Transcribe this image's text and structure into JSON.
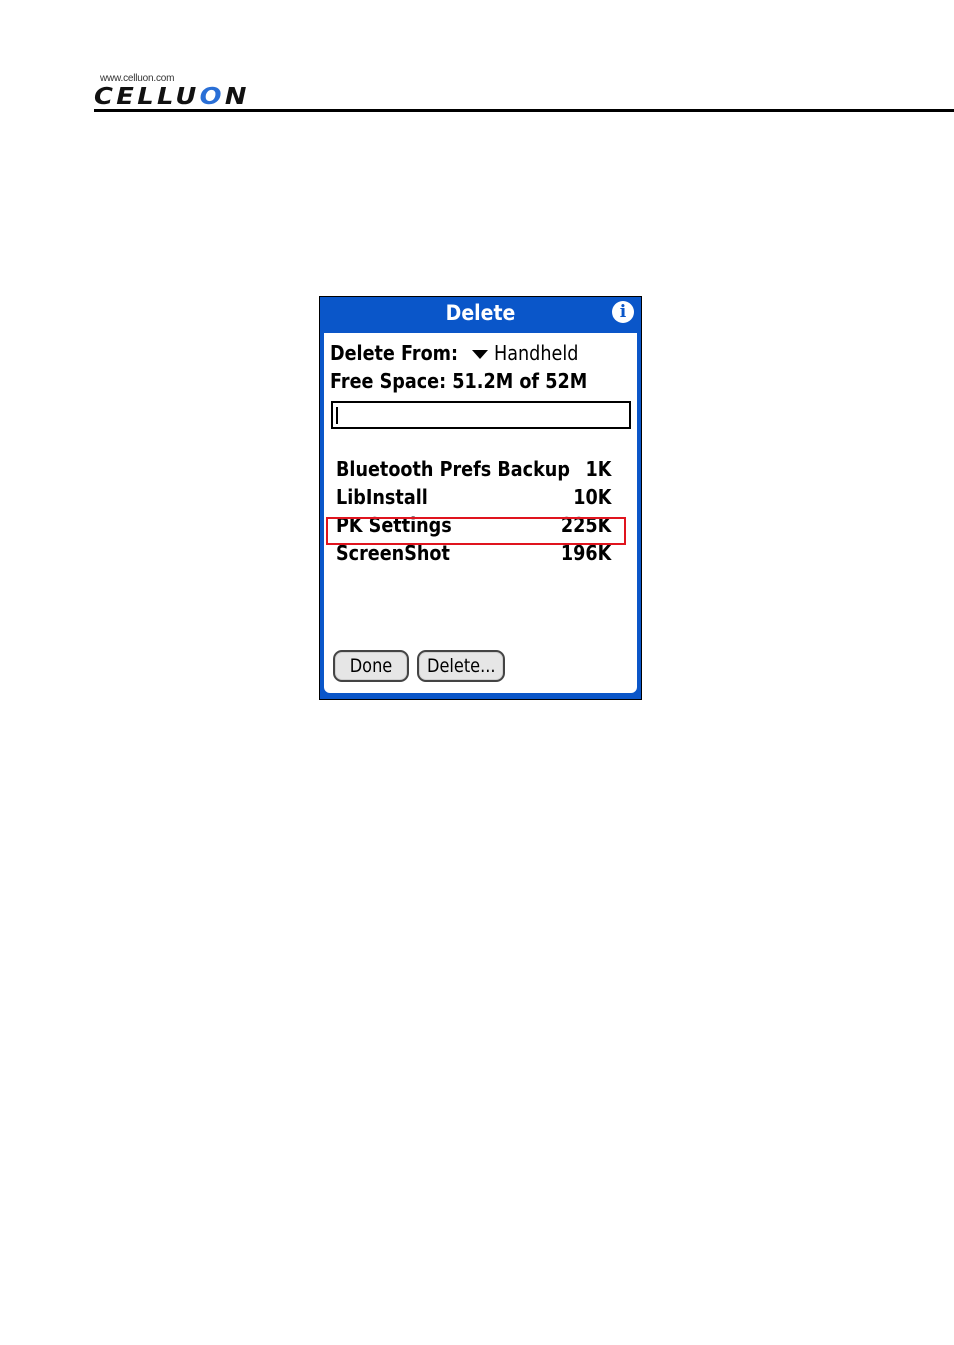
{
  "header": {
    "logo_url": "www.celluon.com",
    "logo_text_before": "CELLU",
    "logo_text_ring": "O",
    "logo_text_after": "N"
  },
  "dialog": {
    "title": "Delete",
    "info_icon_glyph": "i",
    "delete_from_label": "Delete From:",
    "delete_from_value": "Handheld",
    "free_space": "Free Space: 51.2M of 52M",
    "search_value": "",
    "files": [
      {
        "name": "Bluetooth Prefs Backup",
        "size": "1K"
      },
      {
        "name": "LibInstall",
        "size": "10K"
      },
      {
        "name": "PK Settings",
        "size": "225K"
      },
      {
        "name": "ScreenShot",
        "size": "196K"
      }
    ],
    "highlighted_file": "PK Settings",
    "done_label": "Done",
    "delete_label": "Delete..."
  },
  "colors": {
    "dialog_blue": "#0a56c9",
    "highlight_red": "#e0141e"
  }
}
